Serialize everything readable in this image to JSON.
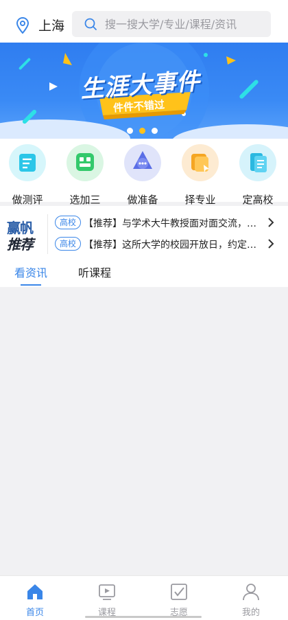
{
  "header": {
    "city": "上海",
    "search_placeholder": "搜一搜大学/专业/课程/资讯"
  },
  "banner": {
    "title": "生涯大事件",
    "subtitle": "件件不错过",
    "active_dot": 1,
    "dot_count": 3
  },
  "quick_actions": [
    {
      "label": "做测评",
      "icon": "assessment-icon"
    },
    {
      "label": "选加三",
      "icon": "select-subjects-icon"
    },
    {
      "label": "做准备",
      "icon": "prepare-icon"
    },
    {
      "label": "择专业",
      "icon": "choose-major-icon"
    },
    {
      "label": "定高校",
      "icon": "choose-college-icon"
    }
  ],
  "recommend": {
    "logo_line1": "赢帆",
    "logo_line2": "推荐",
    "items": [
      {
        "tag": "高校",
        "text": "【推荐】与学术大牛教授面对面交流，与名校学子畅谈学习生活"
      },
      {
        "tag": "高校",
        "text": "【推荐】这所大学的校园开放日，约定你了，快来报名参加吧"
      }
    ]
  },
  "tabs": {
    "items": [
      "看资讯",
      "听课程"
    ],
    "active": 0
  },
  "bottom_nav": {
    "items": [
      {
        "label": "首页",
        "icon": "home-icon",
        "active": true
      },
      {
        "label": "课程",
        "icon": "video-icon",
        "active": false
      },
      {
        "label": "志愿",
        "icon": "checkbox-icon",
        "active": false
      },
      {
        "label": "我的",
        "icon": "profile-icon",
        "active": false
      }
    ]
  },
  "colors": {
    "accent": "#3a86e8",
    "inactive": "#9a9aa0",
    "banner_blue": "#2f7df0",
    "banner_yellow": "#ffc21a"
  }
}
